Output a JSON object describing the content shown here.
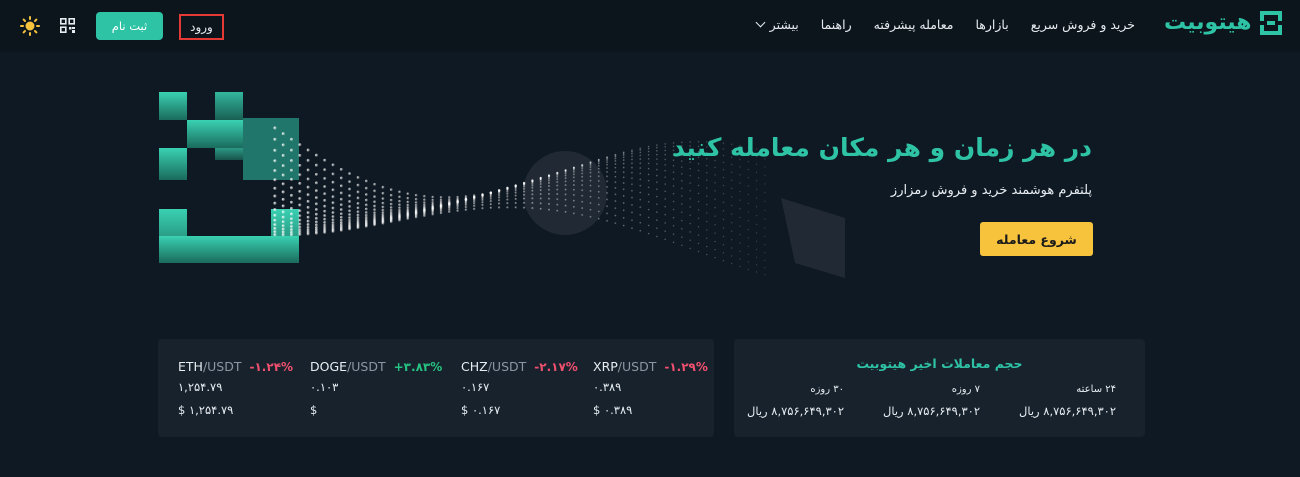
{
  "header": {
    "logo_text": "هیتوبیت",
    "nav": [
      {
        "label": "خرید و فروش سریع"
      },
      {
        "label": "بازارها"
      },
      {
        "label": "معامله پیشرفته"
      },
      {
        "label": "راهنما"
      },
      {
        "label": "بیشتر"
      }
    ],
    "login_label": "ورود",
    "signup_label": "ثبت نام"
  },
  "hero": {
    "title": "در هر زمان و هر مکان معامله کنید",
    "subtitle": "پلتفرم هوشمند خرید و فروش رمزارز",
    "cta_label": "شروع معامله"
  },
  "tickers": [
    {
      "base": "XRP",
      "quote": "/USDT",
      "change": "-۱.۲۹%",
      "price": "۰.۳۸۹",
      "usd": "$ ۰.۳۸۹",
      "direction": "down"
    },
    {
      "base": "CHZ",
      "quote": "/USDT",
      "change": "-۲.۱۷%",
      "price": "۰.۱۶۷",
      "usd": "$ ۰.۱۶۷",
      "direction": "down"
    },
    {
      "base": "DOGE",
      "quote": "/USDT",
      "change": "+۳.۸۳%",
      "price": "۰.۱۰۳",
      "usd": "$",
      "direction": "up"
    },
    {
      "base": "ETH",
      "quote": "/USDT",
      "change": "-۱.۲۴%",
      "price": "۱,۲۵۴.۷۹",
      "usd": "$ ۱,۲۵۴.۷۹",
      "direction": "down"
    }
  ],
  "volume": {
    "title": "حجم معاملات اخیر هیتوبیت",
    "columns": [
      {
        "label": "۲۴ ساعته",
        "value": "۸,۷۵۶,۶۴۹,۳۰۲ ریال"
      },
      {
        "label": "۷ روزه",
        "value": "۸,۷۵۶,۶۴۹,۳۰۲ ریال"
      },
      {
        "label": "۳۰ روزه",
        "value": "۸,۷۵۶,۶۴۹,۳۰۲ ریال"
      }
    ]
  },
  "colors": {
    "accent": "#2fc3a6",
    "cta": "#f7c33d",
    "up": "#26c281",
    "down": "#f0506e",
    "background": "#0f1923",
    "card": "#17222d"
  },
  "icons": [
    "hitobit-logo-icon",
    "chevron-down-icon",
    "qr-code-icon",
    "sun-icon",
    "bitcoin-icon",
    "ethereum-icon"
  ]
}
